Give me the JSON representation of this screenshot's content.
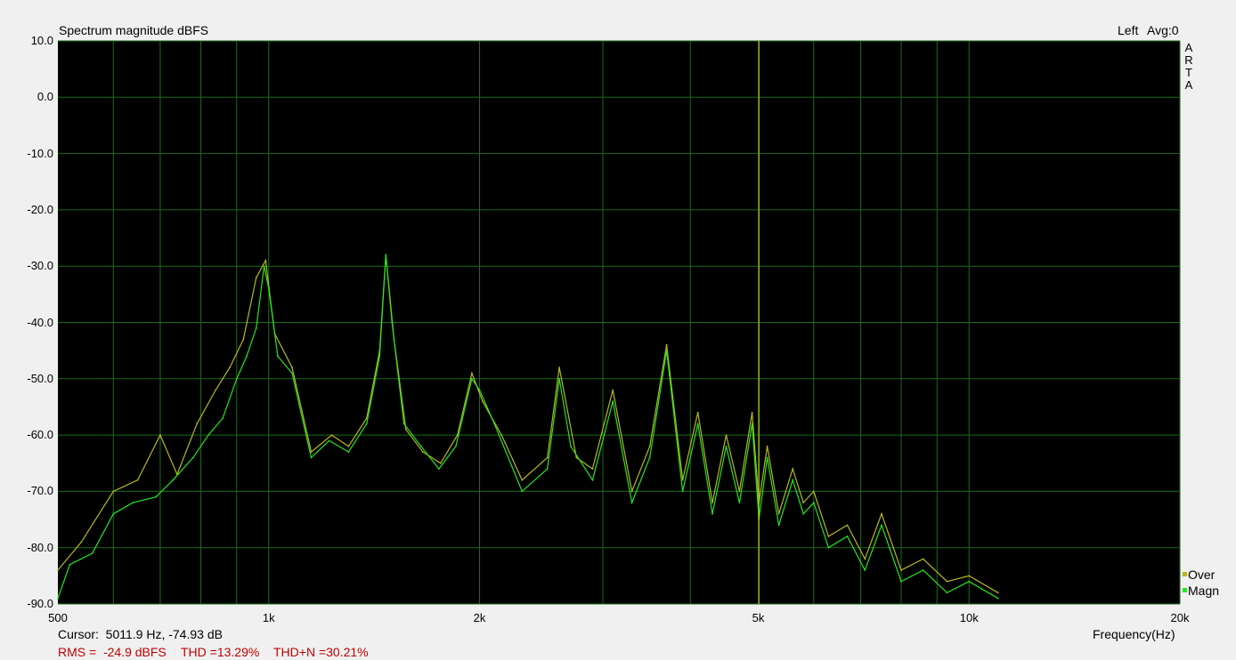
{
  "header": {
    "title": "Spectrum magnitude dBFS",
    "channel": "Left",
    "avg": "Avg:0"
  },
  "brand": "ARTA",
  "footer": {
    "cursor": "Cursor:  5011.9 Hz, -74.93 dB",
    "rms": "RMS =  -24.9 dBFS",
    "thd": "THD =13.29%",
    "thdn": "THD+N =30.21%"
  },
  "colors": {
    "plot_bg": "#000000",
    "grid": "#1a6b1a",
    "magn": "#22e622",
    "over": "#b8b81a",
    "cursor": "#c8c81a",
    "status_red": "#c00000"
  },
  "chart_data": {
    "type": "line",
    "title": "Spectrum magnitude dBFS",
    "xlabel": "Frequency(Hz)",
    "ylabel": "",
    "xscale": "log",
    "xlim": [
      500,
      20000
    ],
    "ylim": [
      -90,
      10
    ],
    "grid": true,
    "legend_placement": "bottom-right",
    "y_ticks": [
      "10.0",
      "0.0",
      "-10.0",
      "-20.0",
      "-30.0",
      "-40.0",
      "-50.0",
      "-60.0",
      "-70.0",
      "-80.0",
      "-90.0"
    ],
    "x_ticks": [
      {
        "value": 500,
        "label": "500"
      },
      {
        "value": 1000,
        "label": "1k"
      },
      {
        "value": 2000,
        "label": "2k"
      },
      {
        "value": 5000,
        "label": "5k"
      },
      {
        "value": 10000,
        "label": "10k"
      },
      {
        "value": 20000,
        "label": "20k"
      }
    ],
    "cursor": {
      "x": 5011.9,
      "y": -74.93
    },
    "series": [
      {
        "name": "Magn",
        "color": "#22e622",
        "points": [
          [
            500,
            -89
          ],
          [
            520,
            -83
          ],
          [
            560,
            -81
          ],
          [
            600,
            -74
          ],
          [
            640,
            -72
          ],
          [
            690,
            -71
          ],
          [
            730,
            -68
          ],
          [
            780,
            -64
          ],
          [
            820,
            -60
          ],
          [
            860,
            -57
          ],
          [
            900,
            -50
          ],
          [
            930,
            -46
          ],
          [
            960,
            -41
          ],
          [
            985,
            -30
          ],
          [
            1000,
            -34
          ],
          [
            1030,
            -46
          ],
          [
            1080,
            -49
          ],
          [
            1150,
            -64
          ],
          [
            1220,
            -61
          ],
          [
            1300,
            -63
          ],
          [
            1380,
            -58
          ],
          [
            1440,
            -46
          ],
          [
            1470,
            -28
          ],
          [
            1500,
            -40
          ],
          [
            1560,
            -58
          ],
          [
            1650,
            -62
          ],
          [
            1750,
            -66
          ],
          [
            1850,
            -62
          ],
          [
            1950,
            -50
          ],
          [
            2000,
            -52
          ],
          [
            2100,
            -58
          ],
          [
            2300,
            -70
          ],
          [
            2500,
            -66
          ],
          [
            2600,
            -50
          ],
          [
            2700,
            -62
          ],
          [
            2900,
            -68
          ],
          [
            3100,
            -54
          ],
          [
            3300,
            -72
          ],
          [
            3500,
            -64
          ],
          [
            3700,
            -45
          ],
          [
            3900,
            -70
          ],
          [
            4100,
            -58
          ],
          [
            4300,
            -74
          ],
          [
            4500,
            -62
          ],
          [
            4700,
            -72
          ],
          [
            4900,
            -58
          ],
          [
            5012,
            -74.93
          ],
          [
            5150,
            -64
          ],
          [
            5350,
            -76
          ],
          [
            5600,
            -68
          ],
          [
            5800,
            -74
          ],
          [
            6000,
            -72
          ],
          [
            6300,
            -80
          ],
          [
            6700,
            -78
          ],
          [
            7100,
            -84
          ],
          [
            7500,
            -76
          ],
          [
            8000,
            -86
          ],
          [
            8600,
            -84
          ],
          [
            9300,
            -88
          ],
          [
            10000,
            -86
          ],
          [
            11000,
            -89
          ]
        ]
      },
      {
        "name": "Over",
        "color": "#b8b81a",
        "points": [
          [
            500,
            -84
          ],
          [
            540,
            -79
          ],
          [
            600,
            -70
          ],
          [
            650,
            -68
          ],
          [
            700,
            -60
          ],
          [
            740,
            -67
          ],
          [
            790,
            -58
          ],
          [
            840,
            -52
          ],
          [
            880,
            -48
          ],
          [
            920,
            -43
          ],
          [
            960,
            -32
          ],
          [
            990,
            -29
          ],
          [
            1020,
            -42
          ],
          [
            1080,
            -48
          ],
          [
            1150,
            -63
          ],
          [
            1230,
            -60
          ],
          [
            1300,
            -62
          ],
          [
            1380,
            -57
          ],
          [
            1440,
            -45
          ],
          [
            1470,
            -28
          ],
          [
            1510,
            -43
          ],
          [
            1570,
            -59
          ],
          [
            1660,
            -63
          ],
          [
            1760,
            -65
          ],
          [
            1860,
            -60
          ],
          [
            1950,
            -49
          ],
          [
            2020,
            -54
          ],
          [
            2150,
            -60
          ],
          [
            2300,
            -68
          ],
          [
            2500,
            -64
          ],
          [
            2600,
            -48
          ],
          [
            2750,
            -64
          ],
          [
            2900,
            -66
          ],
          [
            3100,
            -52
          ],
          [
            3300,
            -70
          ],
          [
            3500,
            -62
          ],
          [
            3700,
            -44
          ],
          [
            3900,
            -68
          ],
          [
            4100,
            -56
          ],
          [
            4300,
            -72
          ],
          [
            4500,
            -60
          ],
          [
            4700,
            -70
          ],
          [
            4900,
            -56
          ],
          [
            5012,
            -72
          ],
          [
            5150,
            -62
          ],
          [
            5350,
            -74
          ],
          [
            5600,
            -66
          ],
          [
            5800,
            -72
          ],
          [
            6000,
            -70
          ],
          [
            6300,
            -78
          ],
          [
            6700,
            -76
          ],
          [
            7100,
            -82
          ],
          [
            7500,
            -74
          ],
          [
            8000,
            -84
          ],
          [
            8600,
            -82
          ],
          [
            9300,
            -86
          ],
          [
            10000,
            -85
          ],
          [
            11000,
            -88
          ]
        ]
      }
    ]
  }
}
